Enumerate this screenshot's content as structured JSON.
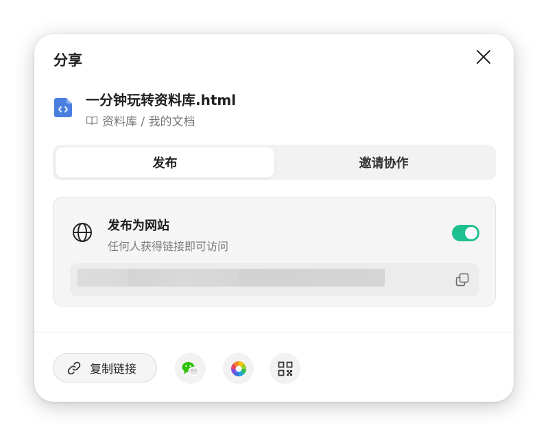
{
  "dialog": {
    "title": "分享",
    "file_name": "一分钟玩转资料库.html",
    "file_path": "资料库 / 我的文档"
  },
  "tabs": [
    {
      "label": "发布",
      "active": true
    },
    {
      "label": "邀请协作",
      "active": false
    }
  ],
  "publish": {
    "title": "发布为网站",
    "subtitle": "任何人获得链接即可访问",
    "enabled": true,
    "url_redacted": true
  },
  "footer": {
    "copy_link_label": "复制链接",
    "share_icons": [
      "wechat-icon",
      "moments-icon",
      "qrcode-icon"
    ]
  },
  "colors": {
    "accent": "#1fbf8f",
    "file_icon": "#4a7fe0"
  }
}
